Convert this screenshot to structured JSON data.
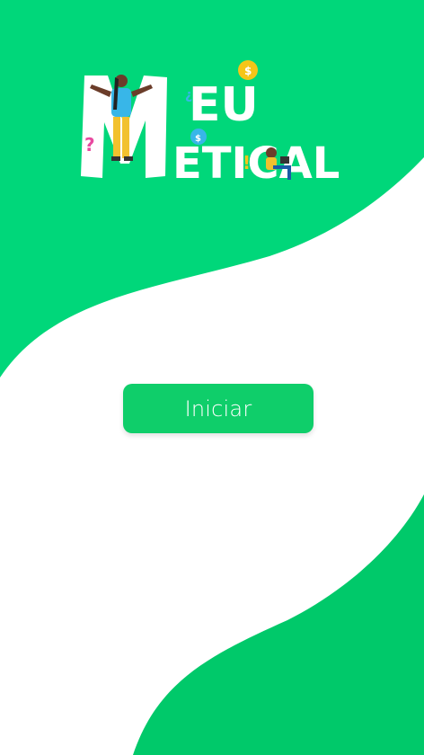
{
  "colors": {
    "primary_green": "#00d77a",
    "button_green": "#0fce6a",
    "bottom_green": "#00c96a",
    "white": "#ffffff"
  },
  "logo": {
    "line1": "EU",
    "line2": "ETICAL",
    "m_letter": "M",
    "icons": [
      "dollar-coin-icon",
      "question-mark-icon",
      "inverted-question-icon",
      "exclamation-icon",
      "dollar-bubble-icon"
    ]
  },
  "start_button": {
    "label": "Iniciar"
  }
}
